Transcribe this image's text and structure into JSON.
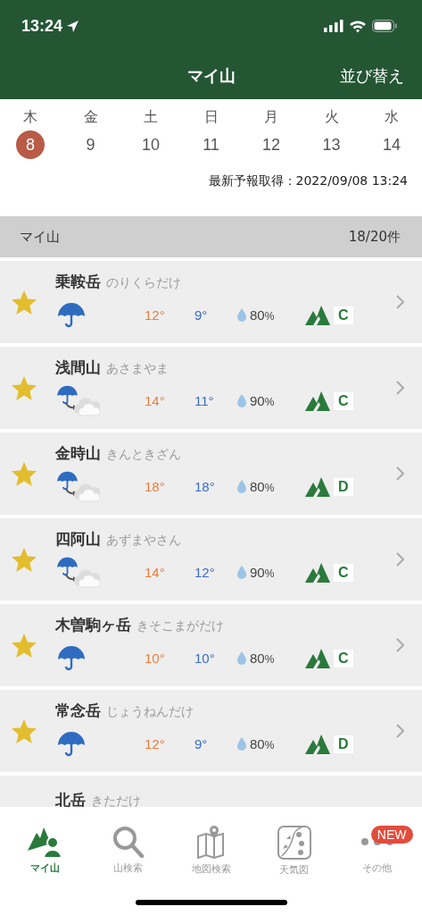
{
  "status_bar": {
    "time": "13:24"
  },
  "nav": {
    "title": "マイ山",
    "action": "並び替え"
  },
  "days": [
    {
      "weekday": "木",
      "date": "8",
      "selected": true
    },
    {
      "weekday": "金",
      "date": "9",
      "selected": false
    },
    {
      "weekday": "土",
      "date": "10",
      "selected": false
    },
    {
      "weekday": "日",
      "date": "11",
      "selected": false
    },
    {
      "weekday": "月",
      "date": "12",
      "selected": false
    },
    {
      "weekday": "火",
      "date": "13",
      "selected": false
    },
    {
      "weekday": "水",
      "date": "14",
      "selected": false
    }
  ],
  "updated": "最新予報取得：2022/09/08 13:24",
  "section": {
    "title": "マイ山",
    "count": "18/20件"
  },
  "mountains": [
    {
      "name": "乗鞍岳",
      "reading": "のりくらだけ",
      "favorite": true,
      "weather": {
        "kind": "rain"
      },
      "high": "12°",
      "low": "9°",
      "precip": "80",
      "unit": "%",
      "grade": "C"
    },
    {
      "name": "浅間山",
      "reading": "あさまやま",
      "favorite": true,
      "weather": {
        "kind": "rain-then-cloudy"
      },
      "high": "14°",
      "low": "11°",
      "precip": "90",
      "unit": "%",
      "grade": "C"
    },
    {
      "name": "金時山",
      "reading": "きんときざん",
      "favorite": true,
      "weather": {
        "kind": "rain-then-cloudy"
      },
      "high": "18°",
      "low": "18°",
      "precip": "80",
      "unit": "%",
      "grade": "D"
    },
    {
      "name": "四阿山",
      "reading": "あずまやさん",
      "favorite": true,
      "weather": {
        "kind": "rain-then-cloudy"
      },
      "high": "14°",
      "low": "12°",
      "precip": "90",
      "unit": "%",
      "grade": "C"
    },
    {
      "name": "木曽駒ヶ岳",
      "reading": "きそこまがだけ",
      "favorite": true,
      "weather": {
        "kind": "rain"
      },
      "high": "10°",
      "low": "10°",
      "precip": "80",
      "unit": "%",
      "grade": "C"
    },
    {
      "name": "常念岳",
      "reading": "じょうねんだけ",
      "favorite": true,
      "weather": {
        "kind": "rain"
      },
      "high": "12°",
      "low": "9°",
      "precip": "80",
      "unit": "%",
      "grade": "D"
    },
    {
      "name": "北岳",
      "reading": "きただけ"
    }
  ],
  "tab_bar": [
    {
      "label": "マイ山",
      "kind": "mymountain",
      "selected": true
    },
    {
      "label": "山検索",
      "kind": "search",
      "selected": false
    },
    {
      "label": "地図検索",
      "kind": "map",
      "selected": false
    },
    {
      "label": "天気図",
      "kind": "weathermap",
      "selected": false
    },
    {
      "badge": "NEW",
      "label": "その他",
      "kind": "more",
      "selected": false
    }
  ]
}
